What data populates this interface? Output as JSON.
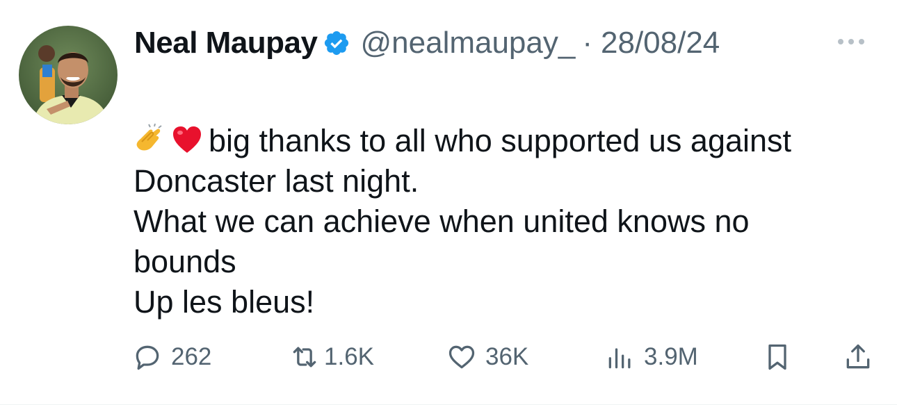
{
  "tweet": {
    "author": {
      "display_name": "Neal Maupay",
      "handle": "@nealmaupay_",
      "verified": true
    },
    "separator": "·",
    "date": "28/08/24",
    "body_lines": [
      "big thanks to all who supported us against",
      "Doncaster last night.",
      "What we can achieve when united knows no",
      "bounds",
      "Up les bleus!"
    ],
    "leading_emojis": [
      "clapping-hands-emoji",
      "red-heart-emoji"
    ],
    "metrics": {
      "replies": "262",
      "reposts": "1.6K",
      "likes": "36K",
      "views": "3.9M"
    },
    "icons": {
      "reply": "reply-icon",
      "repost": "repost-icon",
      "like": "like-icon",
      "views": "views-icon",
      "bookmark": "bookmark-icon",
      "share": "share-icon",
      "more": "more-icon",
      "verified": "verified-badge-icon"
    }
  },
  "colors": {
    "text_primary": "#0f1419",
    "text_secondary": "#536471",
    "verified_blue": "#1d9bf0",
    "heart_red": "#e8112d"
  }
}
